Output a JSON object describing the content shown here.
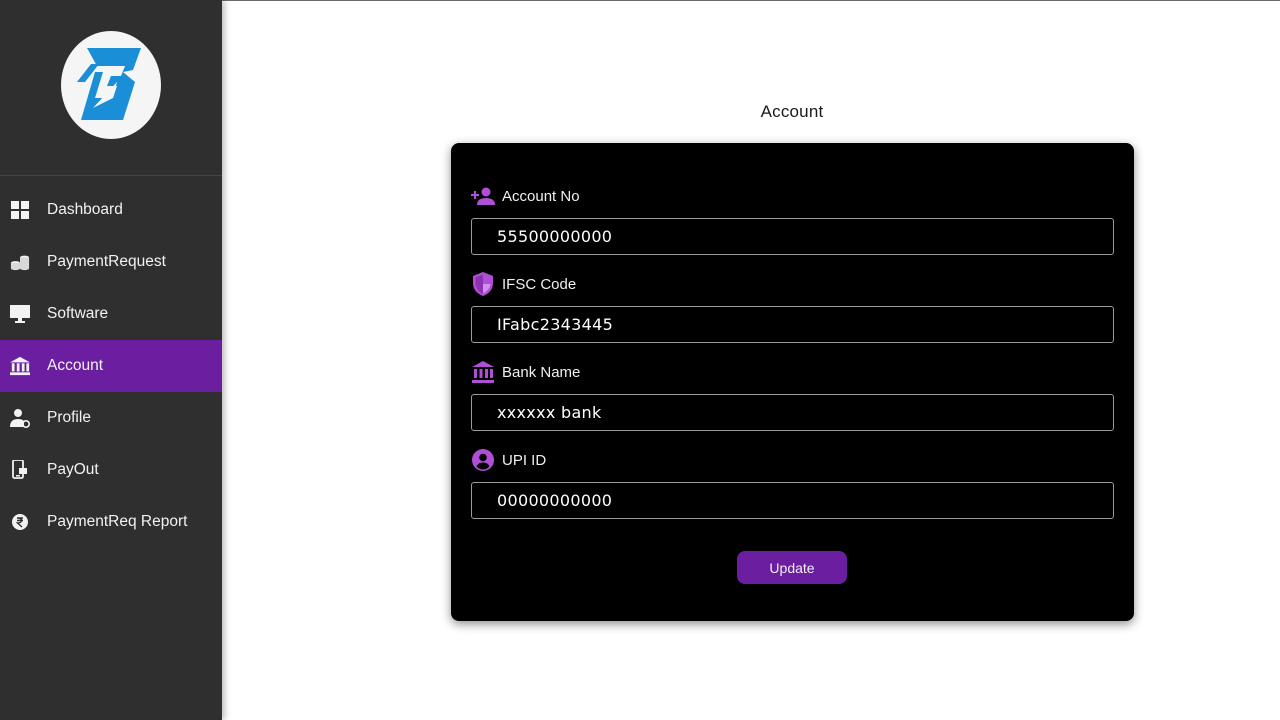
{
  "sidebar": {
    "logo_letter": "B",
    "items": [
      {
        "label": "Dashboard",
        "icon": "dashboard-grid-icon"
      },
      {
        "label": "PaymentRequest",
        "icon": "coins-stack-icon"
      },
      {
        "label": "Software",
        "icon": "monitor-icon"
      },
      {
        "label": "Account",
        "icon": "bank-icon",
        "active": true
      },
      {
        "label": "Profile",
        "icon": "user-settings-icon"
      },
      {
        "label": "PayOut",
        "icon": "mobile-payment-icon"
      },
      {
        "label": "PaymentReq Report",
        "icon": "rupee-circle-icon"
      }
    ]
  },
  "main": {
    "title": "Account",
    "form": {
      "account_no": {
        "label": "Account No",
        "value": "55500000000",
        "icon": "person-add-icon"
      },
      "ifsc": {
        "label": "IFSC Code",
        "value": "IFabc2343445",
        "icon": "shield-icon"
      },
      "bank_name": {
        "label": "Bank Name",
        "value": "xxxxxx bank",
        "icon": "bank-icon"
      },
      "upi_id": {
        "label": "UPI ID",
        "value": "00000000000",
        "icon": "account-circle-icon"
      },
      "submit_label": "Update"
    }
  },
  "colors": {
    "sidebar_bg": "#2f2f2f",
    "accent": "#6b1fa0",
    "icon_purple": "#b04fd6",
    "card_bg": "#000000",
    "logo_blue": "#1a8fd8"
  }
}
